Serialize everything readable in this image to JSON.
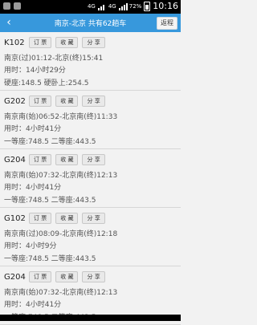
{
  "status": {
    "network": "4G",
    "battery": "72%",
    "time": "10:16"
  },
  "header": {
    "back_icon": "‹",
    "title": "南京-北京 共有62趟车",
    "return_label": "返程"
  },
  "trains": [
    {
      "code": "K102",
      "route": "南京(过)01:12-北京(终)15:41",
      "duration": "用时：14小时29分",
      "prices": "硬座:148.5 硬卧上:254.5"
    },
    {
      "code": "G202",
      "route": "南京南(始)06:52-北京南(终)11:33",
      "duration": "用时：4小时41分",
      "prices": "一等座:748.5 二等座:443.5"
    },
    {
      "code": "G204",
      "route": "南京南(始)07:32-北京南(终)12:13",
      "duration": "用时：4小时41分",
      "prices": "一等座:748.5 二等座:443.5"
    },
    {
      "code": "G102",
      "route": "南京南(过)08:09-北京南(终)12:18",
      "duration": "用时：4小时9分",
      "prices": "一等座:748.5 二等座:443.5"
    },
    {
      "code": "G204",
      "route": "南京南(始)07:32-北京南(终)12:13",
      "duration": "用时：4小时41分",
      "prices": "一等座:748.5 二等座:443.5"
    }
  ],
  "actions": {
    "book": "订 票",
    "collect": "收 藏",
    "share": "分 享"
  }
}
